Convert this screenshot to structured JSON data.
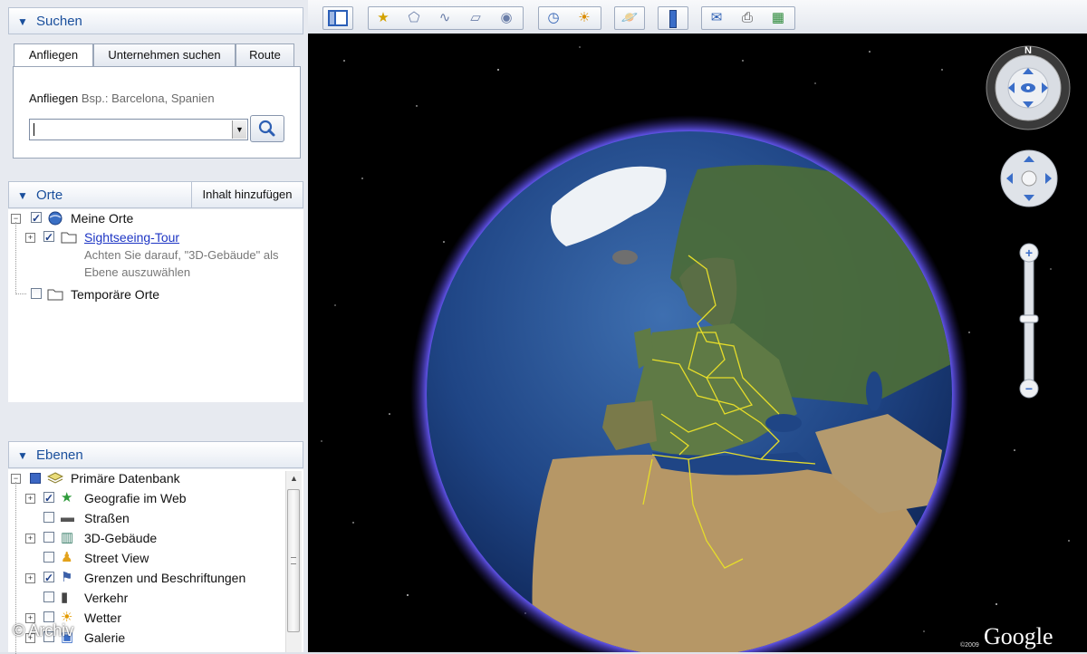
{
  "search_panel": {
    "title": "Suchen",
    "tabs": [
      "Anfliegen",
      "Unternehmen suchen",
      "Route"
    ],
    "fly_label": "Anfliegen",
    "fly_hint": "Bsp.: Barcelona, Spanien",
    "input_value": ""
  },
  "places_panel": {
    "title": "Orte",
    "add_content_label": "Inhalt hinzufügen",
    "items": [
      {
        "label": "Meine Orte",
        "checked": true
      },
      {
        "label": "Sightseeing-Tour",
        "checked": true
      },
      {
        "label": "Temporäre Orte",
        "checked": false
      }
    ],
    "note_line1": "Achten Sie darauf, \"3D-Gebäude\" als",
    "note_line2": "Ebene auszuwählen"
  },
  "layers_panel": {
    "title": "Ebenen",
    "root": "Primäre Datenbank",
    "items": [
      {
        "label": "Geografie im Web",
        "checked": true,
        "icon": "star-icon"
      },
      {
        "label": "Straßen",
        "checked": false,
        "icon": "road-icon"
      },
      {
        "label": "3D-Gebäude",
        "checked": false,
        "icon": "building-icon"
      },
      {
        "label": "Street View",
        "checked": false,
        "icon": "pegman-icon"
      },
      {
        "label": "Grenzen und Beschriftungen",
        "checked": true,
        "icon": "flag-icon"
      },
      {
        "label": "Verkehr",
        "checked": false,
        "icon": "traffic-light-icon"
      },
      {
        "label": "Wetter",
        "checked": false,
        "icon": "sun-icon"
      },
      {
        "label": "Galerie",
        "checked": false,
        "icon": "gallery-icon"
      }
    ]
  },
  "viewer": {
    "compass_north": "N",
    "brand": "Google",
    "copyright_small": "©2009",
    "watermark": "© Archiv"
  },
  "colors": {
    "accent": "#1a4f9c",
    "link": "#1d35c4",
    "border_yellow": "#e6dd2a"
  }
}
